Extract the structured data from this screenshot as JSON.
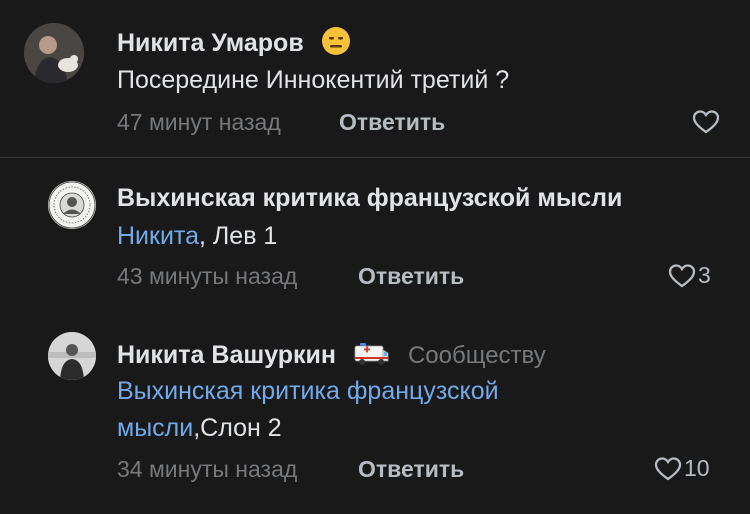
{
  "comments": [
    {
      "author": "Никита Умаров",
      "text": "Посередине Иннокентий третий ?",
      "time": "47 минут назад",
      "reply_label": "Ответить",
      "likes": ""
    },
    {
      "author": "Выхинская критика французской мысли",
      "mention": "Никита",
      "text": ", Лев 1",
      "time": "43 минуты назад",
      "reply_label": "Ответить",
      "likes": "3"
    },
    {
      "author": "Никита Вашуркин",
      "badge": "Сообществу",
      "mention_line1": "Выхинская критика французской",
      "mention_line2": "мысли",
      "text": ",Слон 2",
      "time": "34 минуты назад",
      "reply_label": "Ответить",
      "likes": "10"
    }
  ],
  "colors": {
    "background": "#19191a",
    "link": "#71aaeb",
    "secondary": "#76787a"
  }
}
